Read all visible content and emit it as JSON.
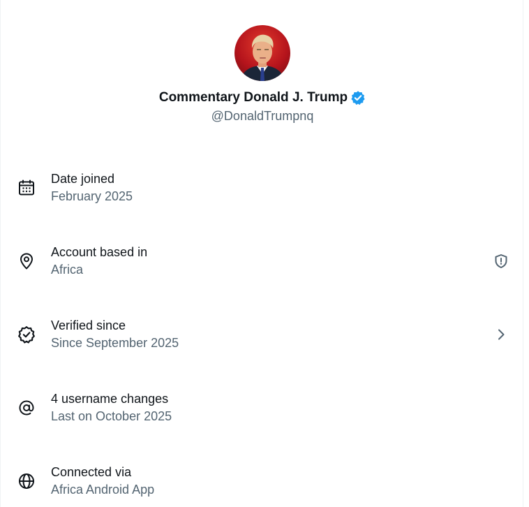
{
  "profile": {
    "display_name": "Commentary Donald J. Trump",
    "handle": "@DonaldTrumpnq",
    "verified": true,
    "badge_color": "#1d9bf0"
  },
  "rows": [
    {
      "label": "Date joined",
      "value": "February 2025",
      "icon": "calendar-icon"
    },
    {
      "label": "Account based in",
      "value": "Africa",
      "icon": "location-pin-icon",
      "trailing_icon": "shield-alert-icon"
    },
    {
      "label": "Verified since",
      "value": "Since September 2025",
      "icon": "verified-check-icon",
      "trailing_icon": "chevron-right-icon"
    },
    {
      "label": "4 username changes",
      "value": "Last on October 2025",
      "icon": "at-sign-icon"
    },
    {
      "label": "Connected via",
      "value": "Africa Android App",
      "icon": "globe-icon"
    }
  ],
  "colors": {
    "primary_text": "#0f1419",
    "secondary_text": "#536471",
    "border": "#eff3f4"
  }
}
